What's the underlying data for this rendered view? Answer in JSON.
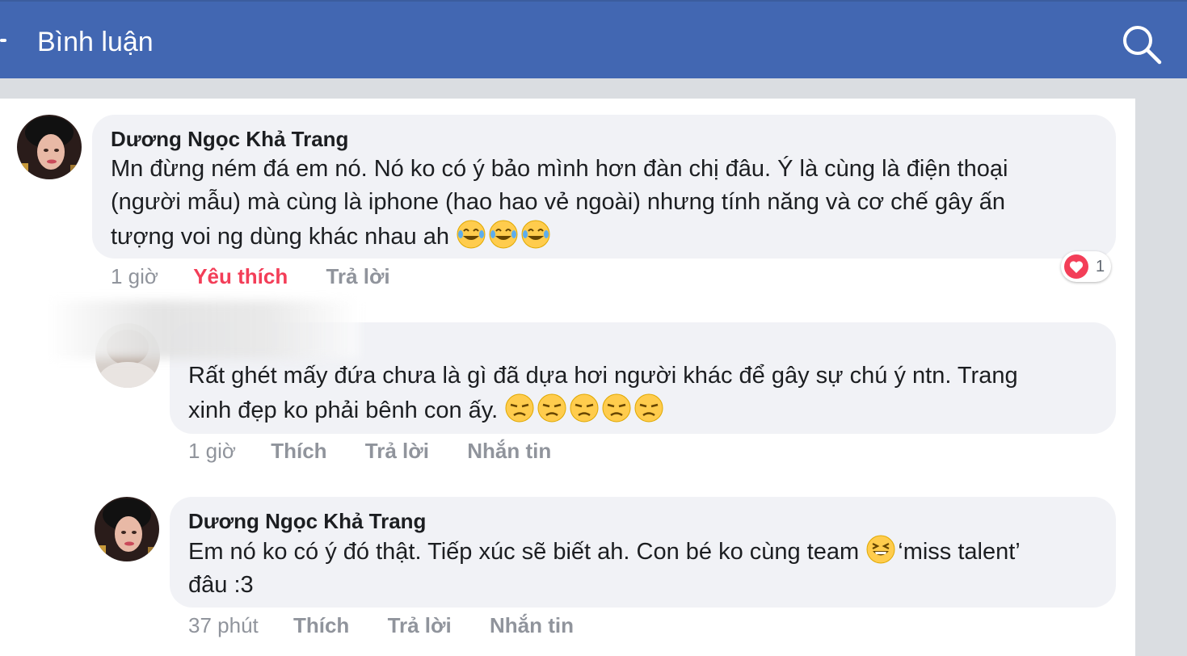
{
  "header": {
    "title": "Bình luận",
    "back_icon": "back-icon",
    "search_icon": "search-icon"
  },
  "colors": {
    "header_bg": "#4267b2",
    "bubble_bg": "#f1f2f6",
    "liked": "#f33e58",
    "meta": "#90949c"
  },
  "comments": [
    {
      "author": "Dương Ngọc Khả Trang",
      "text_lines": [
        "Mn đừng ném đá em nó. Nó ko có ý bảo mình hơn đàn chị đâu. Ý là cùng là điện thoại",
        "(người mẫu) mà cùng là iphone (hao hao vẻ ngoài) nhưng tính năng và cơ chế gây ấn",
        "tượng voi ng dùng khác nhau ah"
      ],
      "emojis": [
        "joy-emoji",
        "joy-emoji",
        "joy-emoji"
      ],
      "time": "1 giờ",
      "like": "Yêu thích",
      "reply": "Trả lời",
      "reaction": {
        "icon": "heart-icon",
        "count": "1"
      }
    },
    {
      "author": "",
      "text_lines": [
        "Rất ghét mấy đứa chưa là gì đã dựa hơi người khác để gây sự chú ý ntn. Trang",
        "xinh đẹp ko phải bênh con ấy."
      ],
      "emojis": [
        "unamused-emoji",
        "unamused-emoji",
        "unamused-emoji",
        "unamused-emoji",
        "unamused-emoji"
      ],
      "time": "1 giờ",
      "like": "Thích",
      "reply": "Trả lời",
      "message": "Nhắn tin"
    },
    {
      "author": "Dương Ngọc Khả Trang",
      "text_line1_a": "Em nó ko có ý đó thật. Tiếp xúc sẽ biết ah. Con bé ko cùng team ",
      "text_line1_b": "‘miss talent’",
      "text_line2": "đâu :3",
      "emoji": "laughing-emoji",
      "time": "37 phút",
      "like": "Thích",
      "reply": "Trả lời",
      "message": "Nhắn tin"
    }
  ]
}
